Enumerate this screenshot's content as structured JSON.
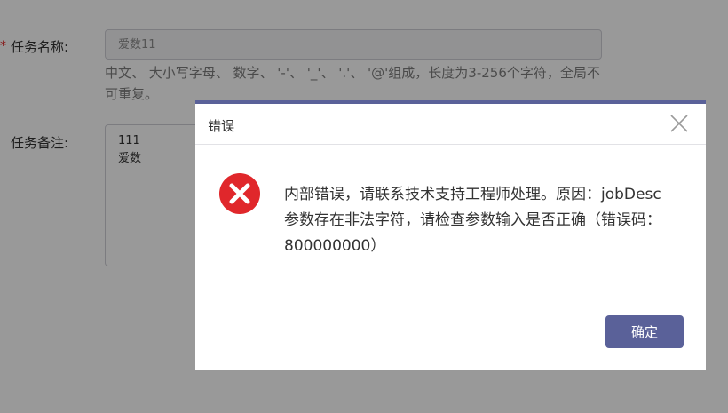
{
  "form": {
    "required_mark": "*",
    "name_label": "任务名称:",
    "name_value": "爱数11",
    "name_hint": "中文、 大小写字母、 数字、 '-'、 '_'、 '.'、 '@'组成，长度为3-256个字符，全局不可重复。",
    "desc_label": "任务备注:",
    "desc_value": "111\n爱数"
  },
  "dialog": {
    "title": "错误",
    "message": "内部错误，请联系技术支持工程师处理。原因：jobDesc参数存在非法字符，请检查参数输入是否正确（错误码：800000000）",
    "ok_label": "确定",
    "icon": "error-icon",
    "close_icon": "close-icon"
  },
  "colors": {
    "accent": "#5a6199",
    "error": "#e0272b"
  }
}
